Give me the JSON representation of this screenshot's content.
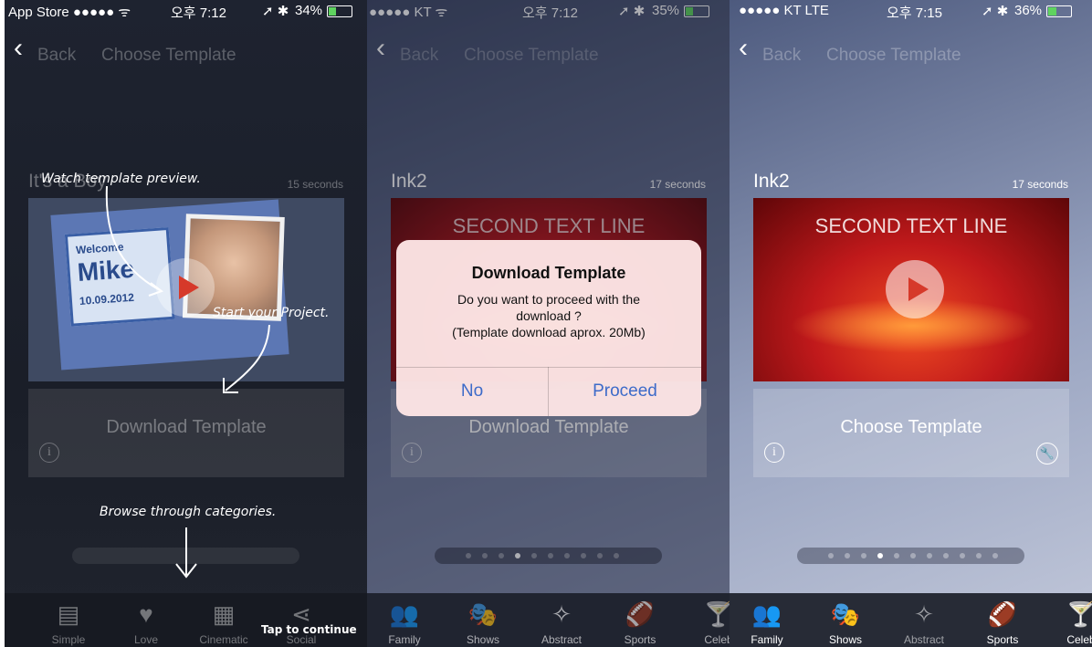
{
  "panel1": {
    "status": {
      "left": "App Store ●●●●● ᯤ",
      "time": "오후 7:12",
      "battery": "34%",
      "battery_level": 0.34
    },
    "nav": {
      "back": "Back",
      "title": "Choose Template"
    },
    "template": {
      "name": "It's a Boy",
      "duration": "15 seconds"
    },
    "video": {
      "welcome": "Welcome",
      "baby_name": "Mike",
      "date": "10.09.2012"
    },
    "button": {
      "label": "Download Template"
    },
    "annotations": {
      "preview": "Watch template preview.",
      "start": "Start your Project.",
      "browse": "Browse through categories.",
      "continue": "Tap to continue"
    },
    "tabs": [
      {
        "label": "Simple",
        "icon": "document-icon"
      },
      {
        "label": "Love",
        "icon": "heart-icon"
      },
      {
        "label": "Cinematic",
        "icon": "film-icon"
      },
      {
        "label": "Social",
        "icon": "share-icon"
      }
    ]
  },
  "panel2": {
    "status": {
      "left": "●●●●● KT ᯤ",
      "time": "오후 7:12",
      "battery": "35%",
      "battery_level": 0.35
    },
    "nav": {
      "back": "Back",
      "title": "Choose Template"
    },
    "template": {
      "name": "Ink2",
      "duration": "17 seconds"
    },
    "video": {
      "text": "SECOND TEXT LINE"
    },
    "button": {
      "label": "Download Template"
    },
    "alert": {
      "title": "Download Template",
      "message_line1": "Do you want to proceed with the",
      "message_line2": "download ?",
      "message_line3": "(Template download aprox. 20Mb)",
      "no": "No",
      "proceed": "Proceed"
    },
    "tabs": [
      {
        "label": "Family",
        "icon": "family-icon"
      },
      {
        "label": "Shows",
        "icon": "masks-icon"
      },
      {
        "label": "Abstract",
        "icon": "wand-icon"
      },
      {
        "label": "Sports",
        "icon": "football-icon"
      },
      {
        "label": "Celeb",
        "icon": "glass-icon"
      }
    ]
  },
  "panel3": {
    "status": {
      "left": "●●●●● KT  LTE",
      "time": "오후 7:15",
      "battery": "36%",
      "battery_level": 0.36
    },
    "nav": {
      "back": "Back",
      "title": "Choose Template"
    },
    "template": {
      "name": "Ink2",
      "duration": "17 seconds"
    },
    "video": {
      "text": "SECOND TEXT LINE"
    },
    "button": {
      "label": "Choose Template"
    },
    "tabs": [
      {
        "label": "Family",
        "icon": "family-icon"
      },
      {
        "label": "Shows",
        "icon": "masks-icon"
      },
      {
        "label": "Abstract",
        "icon": "wand-icon"
      },
      {
        "label": "Sports",
        "icon": "football-icon"
      },
      {
        "label": "Celeb",
        "icon": "glass-icon"
      }
    ]
  },
  "colors": {
    "alert_button": "#3d6bc9",
    "video_red": "#c0191b",
    "battery_green": "#5fd35f"
  }
}
